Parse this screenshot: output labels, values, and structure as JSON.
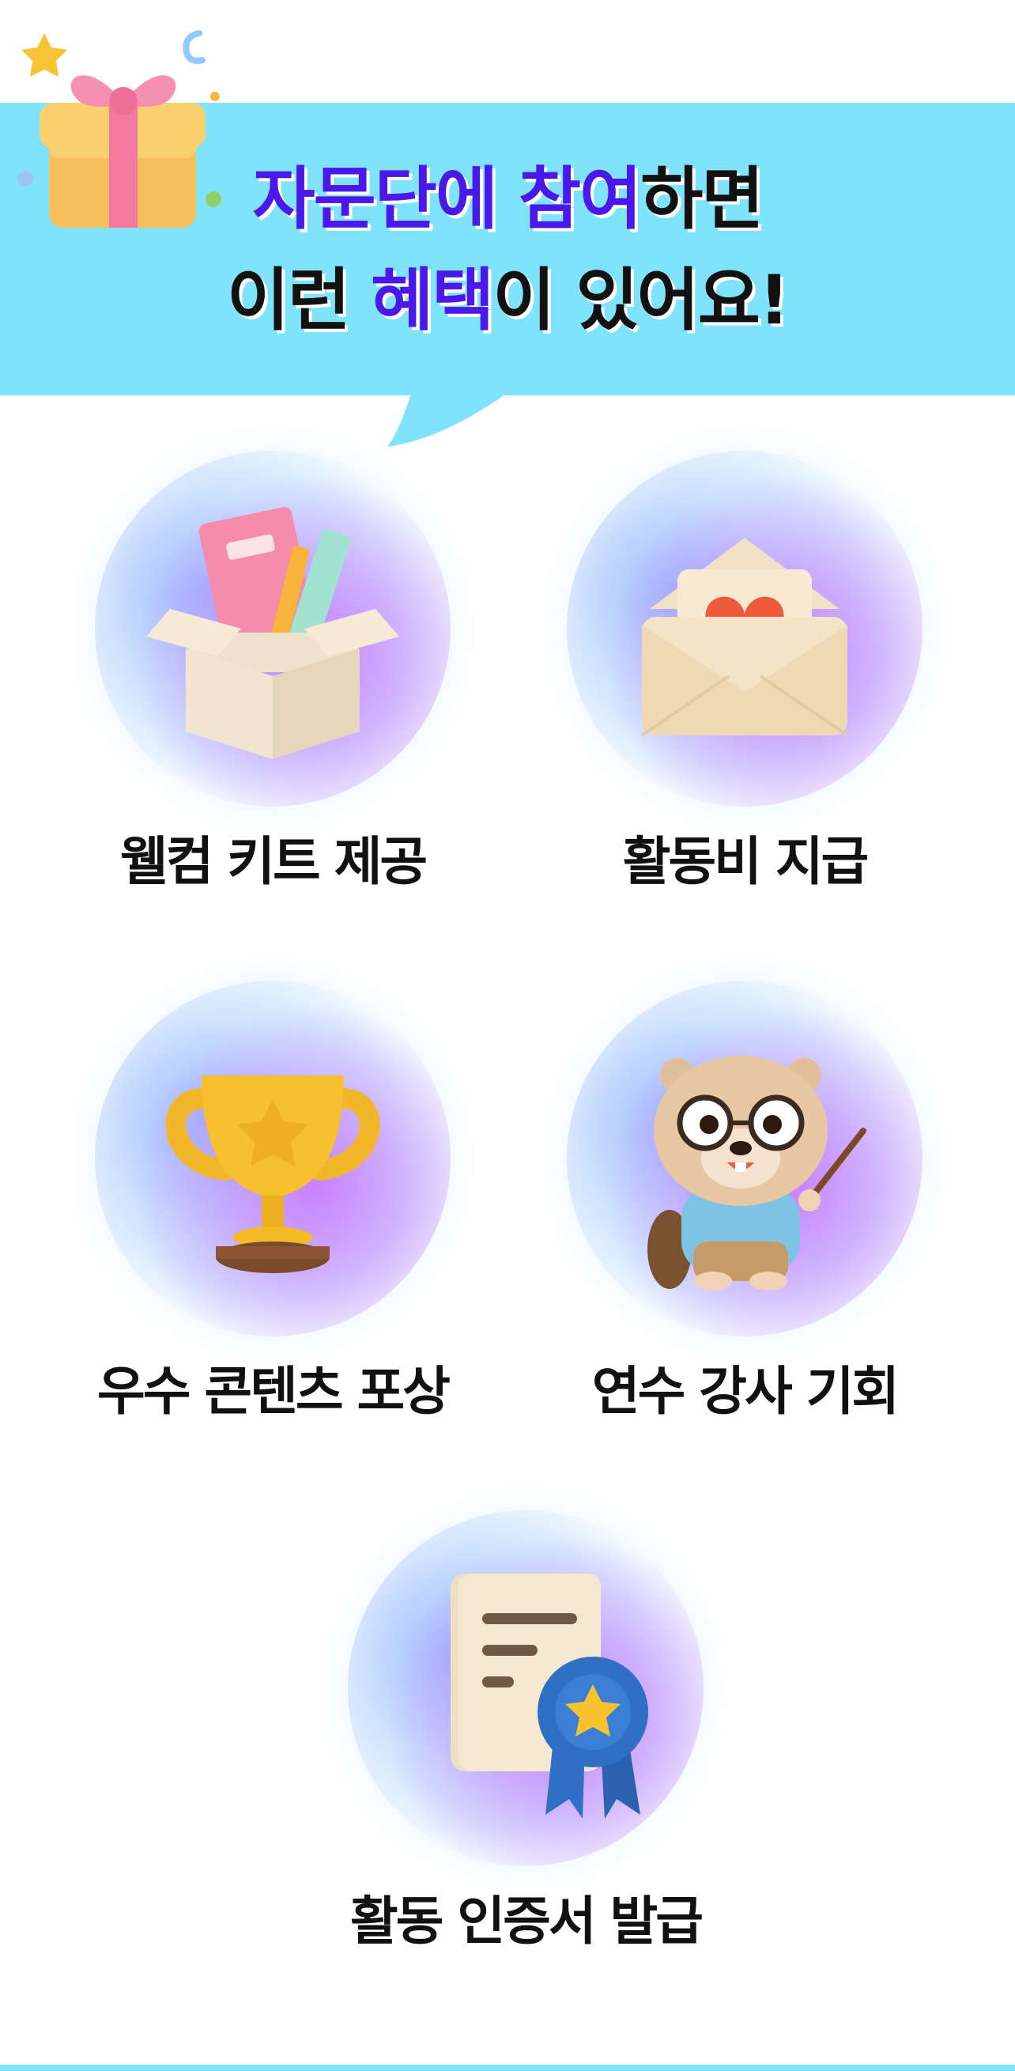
{
  "colors": {
    "banner": "#7fe3fb",
    "highlight": "#4a18e8",
    "text": "#111111"
  },
  "header": {
    "line1": {
      "highlight_a": "자문단에",
      "space": " ",
      "highlight_b": "참여",
      "rest": "하면"
    },
    "line2": {
      "lead": "이런 ",
      "highlight": "혜택",
      "rest": "이 있어요!"
    },
    "decoration_icon": "gift-box-icon"
  },
  "benefits": [
    {
      "label": "웰컴 키트 제공",
      "icon": "welcome-kit-box-icon"
    },
    {
      "label": "활동비 지급",
      "icon": "heart-envelope-icon"
    },
    {
      "label": "우수 콘텐츠 포상",
      "icon": "trophy-icon"
    },
    {
      "label": "연수 강사 기회",
      "icon": "beaver-teacher-icon"
    },
    {
      "label": "활동 인증서 발급",
      "icon": "certificate-medal-icon"
    }
  ]
}
